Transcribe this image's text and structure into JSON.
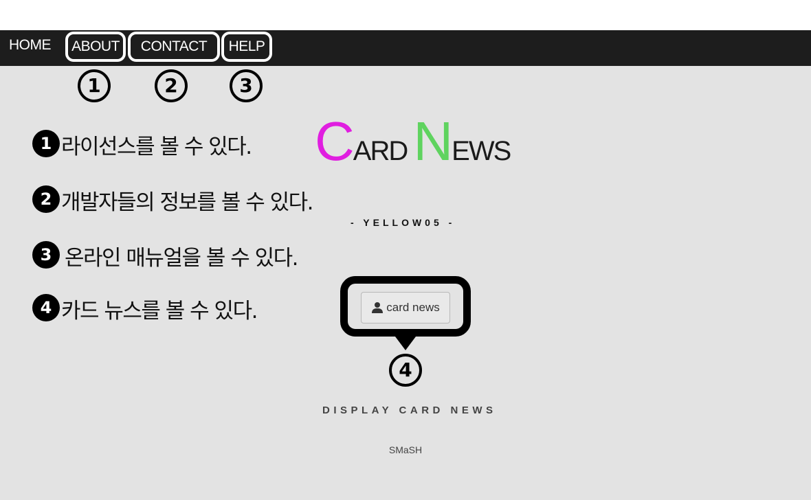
{
  "nav": {
    "home": "HOME",
    "about": "ABOUT",
    "contact": "CONTACT",
    "help": "HELP"
  },
  "markers": {
    "m1": "1",
    "m2": "2",
    "m3": "3",
    "m4": "4"
  },
  "features": [
    {
      "num": "1",
      "text": "라이선스를 볼 수 있다."
    },
    {
      "num": "2",
      "text": "개발자들의 정보를 볼 수 있다."
    },
    {
      "num": "3",
      "text": "온라인 매뉴얼을 볼 수 있다."
    },
    {
      "num": "4",
      "text": "카드 뉴스를 볼 수 있다."
    }
  ],
  "brand": {
    "c": "C",
    "ard": "ARD",
    "n": "N",
    "ews": "EWS",
    "color_c": "#e01ee0",
    "color_n": "#5fd35f"
  },
  "subtitle": "- YELLOW05 -",
  "card_button": {
    "icon": "user-icon",
    "label": "card news"
  },
  "display_title": "DISPLAY CARD NEWS",
  "footer": "SMaSH"
}
